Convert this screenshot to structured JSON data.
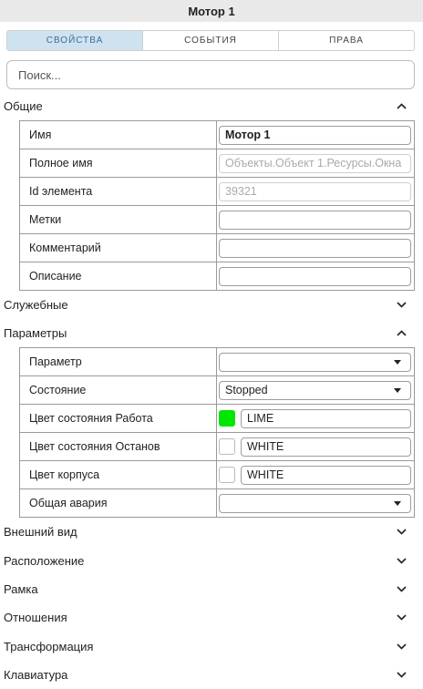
{
  "title": "Мотор 1",
  "tabs": [
    {
      "label": "СВОЙСТВА",
      "active": true
    },
    {
      "label": "СОБЫТИЯ",
      "active": false
    },
    {
      "label": "ПРАВА",
      "active": false
    }
  ],
  "search": {
    "placeholder": "Поиск..."
  },
  "general": {
    "title": "Общие",
    "expanded": true,
    "rows": {
      "name": {
        "label": "Имя",
        "value": "Мотор 1"
      },
      "full_name": {
        "label": "Полное имя",
        "value": "Объекты.Объект 1.Ресурсы.Окна"
      },
      "id": {
        "label": "Id элемента",
        "value": "39321"
      },
      "tags": {
        "label": "Метки",
        "value": ""
      },
      "comment": {
        "label": "Комментарий",
        "value": ""
      },
      "description": {
        "label": "Описание",
        "value": ""
      }
    }
  },
  "service": {
    "title": "Служебные",
    "expanded": false
  },
  "params": {
    "title": "Параметры",
    "expanded": true,
    "rows": {
      "param": {
        "label": "Параметр",
        "value": ""
      },
      "state": {
        "label": "Состояние",
        "value": "Stopped"
      },
      "color_work": {
        "label": "Цвет состояния Работа",
        "value": "LIME",
        "color": "#00e600"
      },
      "color_stop": {
        "label": "Цвет состояния Останов",
        "value": "WHITE",
        "color": "#ffffff"
      },
      "color_body": {
        "label": "Цвет корпуса",
        "value": "WHITE",
        "color": "#ffffff"
      },
      "alarm": {
        "label": "Общая авария",
        "value": ""
      }
    }
  },
  "sections": [
    {
      "title": "Внешний вид"
    },
    {
      "title": "Расположение"
    },
    {
      "title": "Рамка"
    },
    {
      "title": "Отношения"
    },
    {
      "title": "Трансформация"
    },
    {
      "title": "Клавиатура"
    }
  ],
  "colors": {
    "accent_tab_bg": "#cfe2f0",
    "accent_tab_text": "#3b6f96",
    "title_bar_bg": "#e9e9e9"
  }
}
